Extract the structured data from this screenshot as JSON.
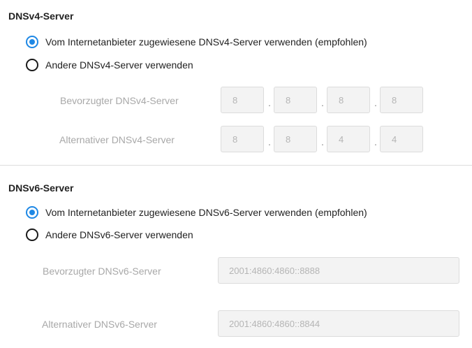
{
  "dnsv4": {
    "title": "DNSv4-Server",
    "option_isp": "Vom Internetanbieter zugewiesene DNSv4-Server verwenden (empfohlen)",
    "option_other": "Andere DNSv4-Server verwenden",
    "preferred_label": "Bevorzugter DNSv4-Server",
    "preferred_octets": [
      "8",
      "8",
      "8",
      "8"
    ],
    "alternate_label": "Alternativer DNSv4-Server",
    "alternate_octets": [
      "8",
      "8",
      "4",
      "4"
    ],
    "separator": "."
  },
  "dnsv6": {
    "title": "DNSv6-Server",
    "option_isp": "Vom Internetanbieter zugewiesene DNSv6-Server verwenden (empfohlen)",
    "option_other": "Andere DNSv6-Server verwenden",
    "preferred_label": "Bevorzugter DNSv6-Server",
    "preferred_value": "2001:4860:4860::8888",
    "alternate_label": "Alternativer DNSv6-Server",
    "alternate_value": "2001:4860:4860::8844"
  },
  "colors": {
    "accent": "#1e88e5",
    "disabled_text": "#a8a8a8",
    "field_bg": "#f3f3f3"
  }
}
